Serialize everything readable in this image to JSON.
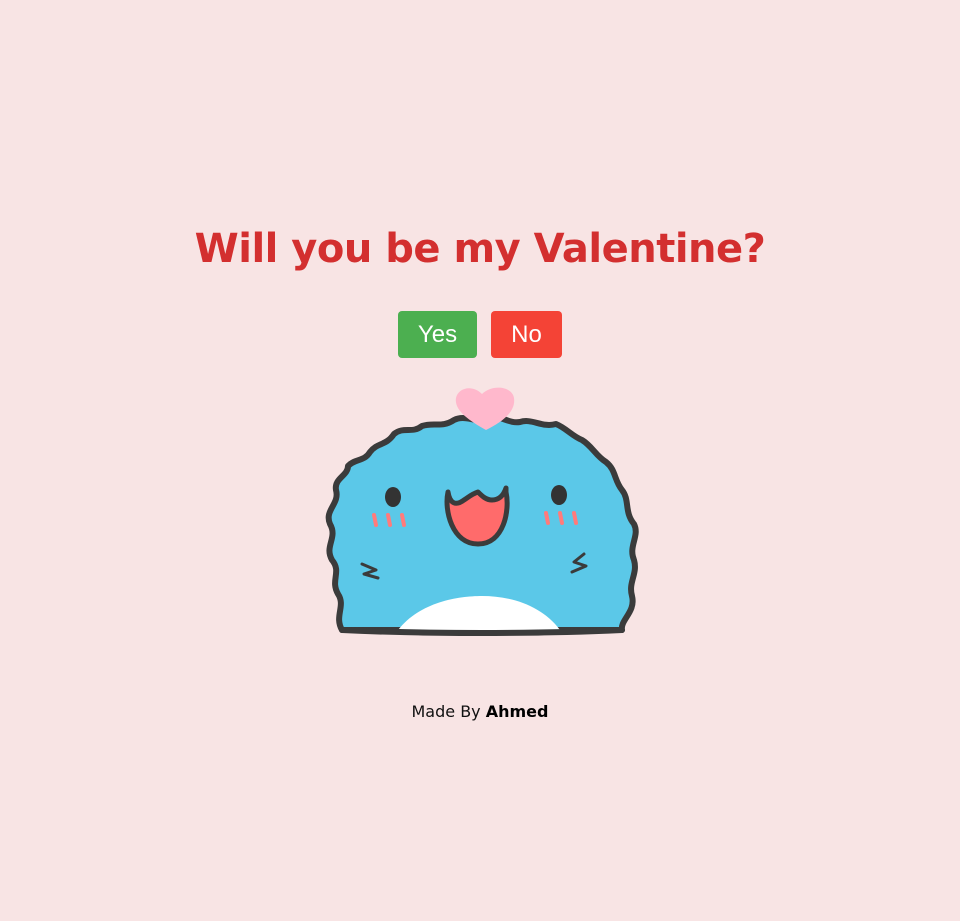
{
  "question": "Will you be my Valentine?",
  "buttons": {
    "yes_label": "Yes",
    "no_label": "No"
  },
  "footer": {
    "prefix": "Made By",
    "author": "Ahmed"
  },
  "colors": {
    "background": "#f8e4e4",
    "question": "#d32f2f",
    "yes": "#4caf50",
    "no": "#f44336"
  },
  "image": {
    "icon": "blue-fluffy-mascot-with-heart"
  }
}
